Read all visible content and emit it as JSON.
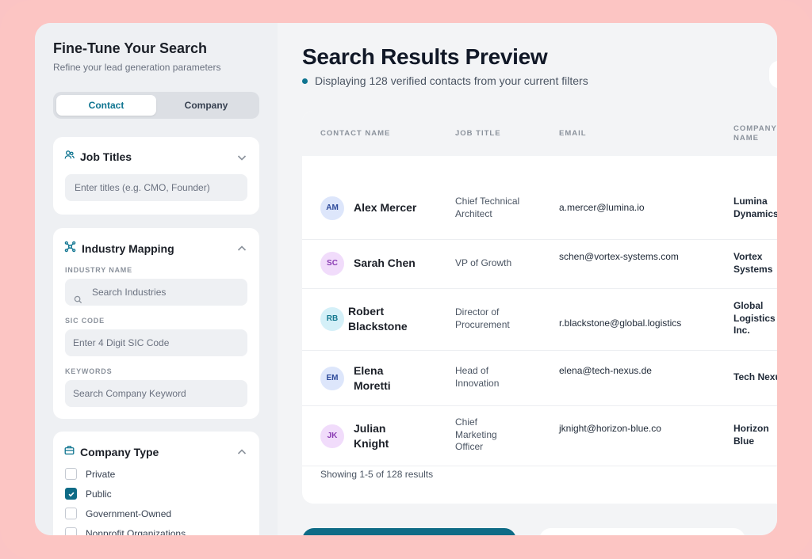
{
  "sidebar": {
    "title": "Fine-Tune Your Search",
    "subtitle": "Refine your lead generation parameters",
    "tabs": [
      {
        "label": "Contact",
        "active": true
      },
      {
        "label": "Company",
        "active": false
      }
    ],
    "job_titles": {
      "title": "Job Titles",
      "placeholder": "Enter titles (e.g. CMO, Founder)"
    },
    "industry": {
      "title": "Industry Mapping",
      "industry_name_label": "INDUSTRY NAME",
      "industry_placeholder": "Search Industries",
      "sic_label": "SIC CODE",
      "sic_placeholder": "Enter 4 Digit SIC Code",
      "keywords_label": "KEYWORDS",
      "keywords_placeholder": "Search Company Keyword"
    },
    "company_type": {
      "title": "Company Type",
      "options": [
        {
          "label": "Private",
          "checked": false
        },
        {
          "label": "Public",
          "checked": true
        },
        {
          "label": "Government-Owned",
          "checked": false
        },
        {
          "label": "Nonprofit Organizations",
          "checked": false
        }
      ]
    }
  },
  "main": {
    "title": "Search Results Preview",
    "subtitle": "Displaying 128 verified contacts from your current filters",
    "columns": {
      "contact_name": "CONTACT NAME",
      "job_title": "JOB TITLE",
      "email": "EMAIL",
      "company_name_1": "COMPANY",
      "company_name_2": "NAME"
    },
    "rows": [
      {
        "initials": "AM",
        "name_1": "Alex Mercer",
        "name_2": "",
        "job_1": "Chief Technical",
        "job_2": "Architect",
        "job_3": "",
        "email": "a.mercer@lumina.io",
        "company_1": "Lumina",
        "company_2": "Dynamics",
        "company_3": ""
      },
      {
        "initials": "SC",
        "name_1": "Sarah Chen",
        "name_2": "",
        "job_1": "VP of Growth",
        "job_2": "",
        "job_3": "",
        "email": "schen@vortex-systems.com",
        "company_1": "Vortex",
        "company_2": "Systems",
        "company_3": ""
      },
      {
        "initials": "RB",
        "name_1": "Robert",
        "name_2": "Blackstone",
        "job_1": "Director of",
        "job_2": "Procurement",
        "job_3": "",
        "email": "r.blackstone@global.logistics",
        "company_1": "Global",
        "company_2": "Logistics",
        "company_3": "Inc."
      },
      {
        "initials": "EM",
        "name_1": "Elena",
        "name_2": "Moretti",
        "job_1": "Head of",
        "job_2": "Innovation",
        "job_3": "",
        "email": "elena@tech-nexus.de",
        "company_1": "Tech Nexu",
        "company_2": "",
        "company_3": ""
      },
      {
        "initials": "JK",
        "name_1": "Julian",
        "name_2": "Knight",
        "job_1": "Chief",
        "job_2": "Marketing",
        "job_3": "Officer",
        "email": "jknight@horizon-blue.co",
        "company_1": "Horizon",
        "company_2": "Blue",
        "company_3": ""
      }
    ],
    "footer": "Showing 1-5 of 128 results"
  },
  "colors": {
    "accent": "#0e7490",
    "frame": "#fcc5c3",
    "avatar_blue_bg": "#dde6fb",
    "avatar_blue_fg": "#2d4a9a",
    "avatar_purple_bg": "#f1dcfb",
    "avatar_purple_fg": "#8a3bb3",
    "avatar_cyan_bg": "#d4f0f8",
    "avatar_cyan_fg": "#13788f"
  },
  "icons": {
    "job_titles": "people-icon",
    "industry": "network-icon",
    "company_type": "briefcase-icon",
    "search": "search-icon",
    "chevron_down": "chevron-down-icon",
    "chevron_up": "chevron-up-icon",
    "checkmark": "check-icon"
  }
}
